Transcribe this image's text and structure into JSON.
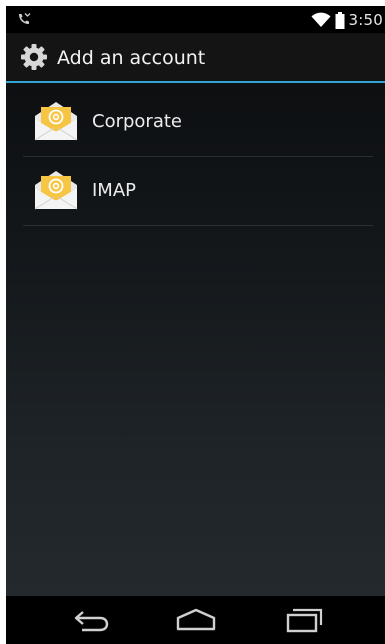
{
  "status_bar": {
    "time": "3:50",
    "left_icon": "missed-call-icon",
    "right_icons": [
      "wifi-icon",
      "battery-icon"
    ]
  },
  "action_bar": {
    "title": "Add an account",
    "icon": "settings-gear-icon",
    "divider_color": "#33a3d6"
  },
  "accounts": [
    {
      "label": "Corporate",
      "icon": "email-envelope-icon"
    },
    {
      "label": "IMAP",
      "icon": "email-envelope-icon"
    }
  ],
  "nav_bar": {
    "buttons": [
      "back-icon",
      "home-icon",
      "recent-apps-icon"
    ]
  }
}
